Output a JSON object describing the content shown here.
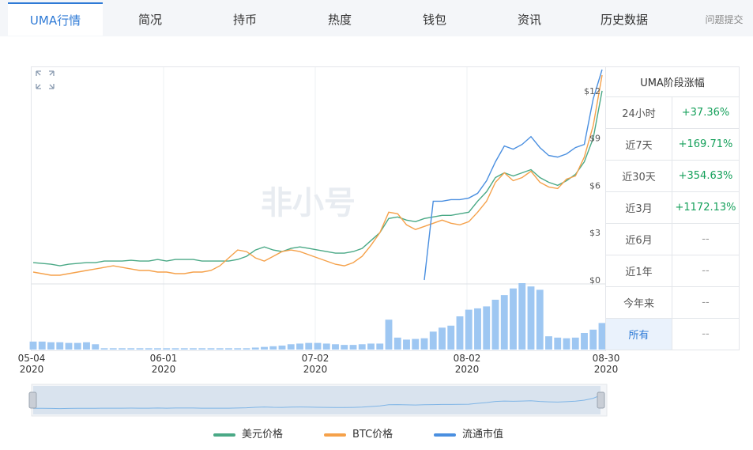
{
  "tabs": [
    {
      "label": "UMA行情",
      "active": true
    },
    {
      "label": "简况"
    },
    {
      "label": "持币"
    },
    {
      "label": "热度"
    },
    {
      "label": "钱包"
    },
    {
      "label": "资讯"
    },
    {
      "label": "历史数据"
    },
    {
      "label": "问题提交"
    }
  ],
  "watermark": "非小号",
  "colors": {
    "price_usd": "#4aa986",
    "price_btc": "#f5a14a",
    "market_cap": "#4a8fe0",
    "volume": "#9ec7f2",
    "accent": "#2e7ad6",
    "positive": "#14a05a"
  },
  "performance": {
    "title": "UMA阶段涨幅",
    "rows": [
      {
        "label": "24小时",
        "value": "+37.36%"
      },
      {
        "label": "近7天",
        "value": "+169.71%"
      },
      {
        "label": "近30天",
        "value": "+354.63%"
      },
      {
        "label": "近3月",
        "value": "+1172.13%"
      },
      {
        "label": "近6月",
        "value": "--"
      },
      {
        "label": "近1年",
        "value": "--"
      },
      {
        "label": "今年来",
        "value": "--"
      },
      {
        "label": "所有",
        "value": "--",
        "selected": true
      }
    ]
  },
  "chart_data": {
    "type": "line",
    "x_axis": {
      "ticks": [
        [
          "05-04",
          "2020"
        ],
        [
          "06-01",
          "2020"
        ],
        [
          "07-02",
          "2020"
        ],
        [
          "08-02",
          "2020"
        ],
        [
          "08-30",
          "2020"
        ]
      ],
      "range": [
        "2020-05-04",
        "2020-08-30"
      ]
    },
    "y_axis": {
      "ticks": [
        "$0",
        "$3",
        "$6",
        "$9",
        "$12"
      ],
      "range": [
        0,
        13.5
      ],
      "position": "right"
    },
    "legend": {
      "position": "bottom",
      "items": [
        "美元价格",
        "BTC价格",
        "流通市值"
      ]
    },
    "series": [
      {
        "name": "美元价格",
        "values": [
          1.1,
          1.05,
          1.0,
          0.9,
          1.0,
          1.05,
          1.1,
          1.1,
          1.2,
          1.2,
          1.2,
          1.25,
          1.2,
          1.2,
          1.3,
          1.2,
          1.3,
          1.3,
          1.3,
          1.2,
          1.2,
          1.2,
          1.2,
          1.3,
          1.5,
          1.9,
          2.1,
          1.9,
          1.8,
          2.0,
          2.1,
          2.0,
          1.9,
          1.8,
          1.7,
          1.7,
          1.8,
          2.0,
          2.5,
          3.0,
          3.9,
          4.0,
          3.8,
          3.7,
          3.9,
          4.0,
          4.1,
          4.1,
          4.2,
          4.3,
          5.0,
          5.6,
          6.5,
          6.8,
          6.6,
          6.8,
          7.0,
          6.5,
          6.2,
          6.0,
          6.3,
          6.7,
          7.5,
          9.0,
          12.0
        ]
      },
      {
        "name": "BTC价格",
        "values": [
          0.5,
          0.4,
          0.3,
          0.3,
          0.4,
          0.5,
          0.6,
          0.7,
          0.8,
          0.9,
          0.8,
          0.7,
          0.6,
          0.6,
          0.5,
          0.5,
          0.4,
          0.4,
          0.5,
          0.5,
          0.6,
          0.9,
          1.4,
          1.9,
          1.8,
          1.4,
          1.2,
          1.5,
          1.8,
          1.9,
          1.8,
          1.6,
          1.4,
          1.2,
          1.0,
          0.9,
          1.1,
          1.5,
          2.2,
          3.0,
          4.3,
          4.2,
          3.5,
          3.2,
          3.4,
          3.6,
          3.8,
          3.6,
          3.5,
          3.7,
          4.3,
          5.0,
          6.2,
          6.8,
          6.3,
          6.5,
          6.9,
          6.2,
          5.9,
          5.8,
          6.4,
          6.6,
          7.8,
          9.8,
          13.0
        ]
      },
      {
        "name": "流通市值",
        "values": [
          null,
          null,
          null,
          null,
          null,
          null,
          null,
          null,
          null,
          null,
          null,
          null,
          null,
          null,
          null,
          null,
          null,
          null,
          null,
          null,
          null,
          null,
          null,
          null,
          null,
          null,
          null,
          null,
          null,
          null,
          null,
          null,
          null,
          null,
          null,
          null,
          null,
          null,
          null,
          null,
          null,
          null,
          null,
          null,
          0.0,
          5.0,
          5.0,
          5.1,
          5.1,
          5.2,
          5.5,
          6.3,
          7.5,
          8.5,
          8.3,
          8.6,
          9.1,
          8.4,
          7.9,
          7.8,
          8.0,
          8.4,
          8.6,
          11.5,
          14.0
        ]
      }
    ],
    "volume": [
      0.12,
      0.12,
      0.11,
      0.11,
      0.1,
      0.1,
      0.11,
      0.08,
      0.02,
      0.02,
      0.02,
      0.02,
      0.02,
      0.02,
      0.02,
      0.02,
      0.02,
      0.02,
      0.02,
      0.02,
      0.02,
      0.02,
      0.02,
      0.02,
      0.02,
      0.03,
      0.04,
      0.05,
      0.06,
      0.08,
      0.09,
      0.1,
      0.1,
      0.09,
      0.08,
      0.07,
      0.07,
      0.08,
      0.09,
      0.09,
      0.45,
      0.18,
      0.15,
      0.16,
      0.17,
      0.27,
      0.33,
      0.36,
      0.5,
      0.6,
      0.62,
      0.65,
      0.75,
      0.82,
      0.92,
      1.0,
      0.95,
      0.9,
      0.2,
      0.18,
      0.17,
      0.18,
      0.25,
      0.3,
      0.4
    ]
  }
}
